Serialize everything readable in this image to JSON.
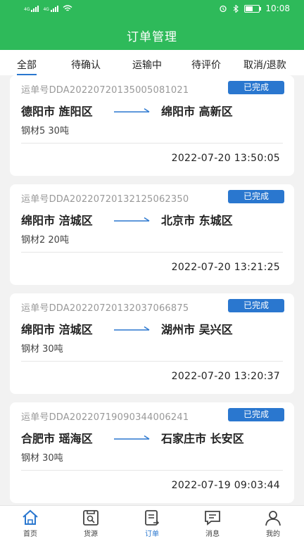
{
  "status_bar": {
    "time": "10:08",
    "signal1_label": "4G",
    "signal2_label": "4G",
    "battery_level": 0.55
  },
  "header": {
    "title": "订单管理"
  },
  "tabs": [
    {
      "label": "全部",
      "active": true
    },
    {
      "label": "待确认",
      "active": false
    },
    {
      "label": "运输中",
      "active": false
    },
    {
      "label": "待评价",
      "active": false
    },
    {
      "label": "取消/退款",
      "active": false
    }
  ],
  "orders": [
    {
      "waybill": "运单号DDA2022072013500508102​1",
      "status": "已完成",
      "from": "德阳市 旌阳区",
      "to": "绵阳市 高新区",
      "cargo": "钢材5 30吨",
      "datetime": "2022-07-20 13:50:05"
    },
    {
      "waybill": "运单号DDA20220720132125062350",
      "status": "已完成",
      "from": "绵阳市 涪城区",
      "to": "北京市 东城区",
      "cargo": "钢材2 20吨",
      "datetime": "2022-07-20 13:21:25"
    },
    {
      "waybill": "运单号DDA20220720132037066875",
      "status": "已完成",
      "from": "绵阳市 涪城区",
      "to": "湖州市 吴兴区",
      "cargo": "钢材 30吨",
      "datetime": "2022-07-20 13:20:37"
    },
    {
      "waybill": "运单号DDA20220719090344006241",
      "status": "已完成",
      "from": "合肥市 瑶海区",
      "to": "石家庄市 长安区",
      "cargo": "钢材 30吨",
      "datetime": "2022-07-19 09:03:44"
    }
  ],
  "bottom_nav": [
    {
      "label": "首页",
      "icon": "home-icon",
      "active": false
    },
    {
      "label": "货源",
      "icon": "cargo-source-icon",
      "active": false
    },
    {
      "label": "订单",
      "icon": "order-icon",
      "active": true
    },
    {
      "label": "消息",
      "icon": "message-icon",
      "active": false
    },
    {
      "label": "我的",
      "icon": "profile-icon",
      "active": false
    }
  ],
  "colors": {
    "header": "#2eba5a",
    "accent": "#2a77cf",
    "background": "#f2f2f2"
  }
}
